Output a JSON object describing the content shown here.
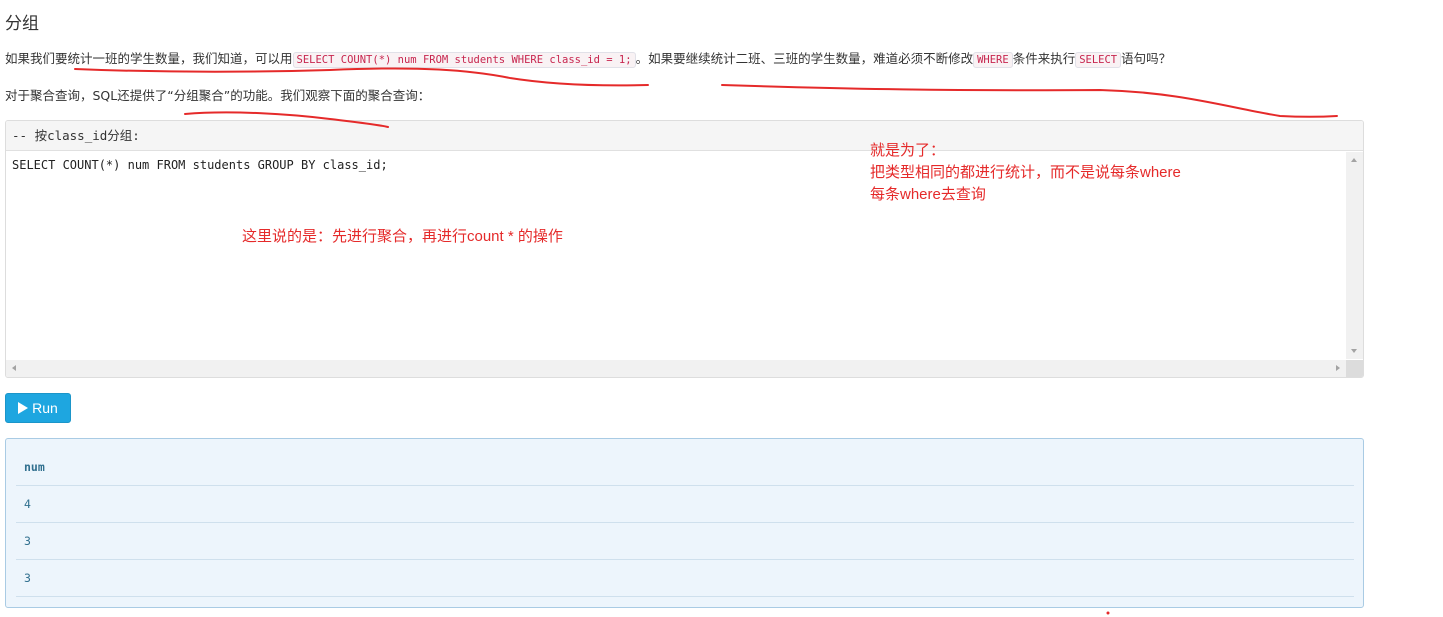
{
  "heading": "分组",
  "paragraph1": {
    "before": "如果我们要统计一班的学生数量，我们知道，可以用",
    "code1": "SELECT COUNT(*) num FROM students WHERE class_id = 1;",
    "middle": "。如果要继续统计二班、三班的学生数量，难道必须不断修改",
    "code2": "WHERE",
    "middle2": "条件来执行",
    "code3": "SELECT",
    "after": "语句吗？"
  },
  "paragraph2": "对于聚合查询，SQL还提供了“分组聚合”的功能。我们观察下面的聚合查询：",
  "editor": {
    "comment": "-- 按class_id分组:",
    "code": "SELECT COUNT(*) num FROM students GROUP BY class_id;"
  },
  "run_button": {
    "label": "Run",
    "icon": "play-icon"
  },
  "result": {
    "columns": [
      "num"
    ],
    "rows": [
      [
        "4"
      ],
      [
        "3"
      ],
      [
        "3"
      ]
    ]
  },
  "annotations": {
    "note1": "这里说的是：先进行聚合，再进行count * 的操作",
    "note2_line1": "就是为了：",
    "note2_line2": "把类型相同的都进行统计，而不是说每条where",
    "note2_line3": "每条where去查询"
  },
  "colors": {
    "annotation": "#e52a2a",
    "run_button": "#1ea6e0",
    "result_bg": "#edf5fc",
    "inline_code": "#c7254e"
  }
}
